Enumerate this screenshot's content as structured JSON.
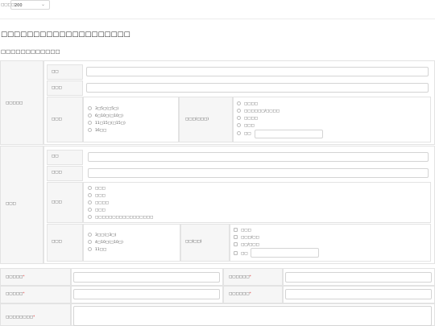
{
  "toolbar": {
    "count_label": "□□□□:",
    "count_value": "200"
  },
  "page_title": "□□□□□□□□□□□□□□□□□□□□",
  "section_title": "□□□□□□□□□□□□",
  "group1": {
    "label": "□□□□□",
    "row1_label": "□□",
    "row2_label": "□□□",
    "row3_label": "□□□",
    "radios": [
      "3□5□(□5□)",
      "6□10□(□10□)",
      "11□15□(□15□)",
      "16□□"
    ],
    "mid_label": "□□□(□□□)",
    "options": [
      "□□□□",
      "□□□□□□/□□□□",
      "□□□□",
      "□□□",
      "□□"
    ]
  },
  "group2": {
    "label": "□□□",
    "row1_label": "□□",
    "row2_label": "□□□",
    "row3_label": "□□□",
    "row3_options": [
      "□□□",
      "□□□",
      "□□□□",
      "□□□",
      "□□□□□□□□□□□□□□□□□"
    ],
    "row4_label": "□□□",
    "radios": [
      "3□□(□3□)",
      "4□10□(□10□)",
      "11□□"
    ],
    "mid_label": "□□(□□)",
    "checks": [
      "□□□",
      "□□□/□□",
      "□□/□□□",
      "□□"
    ]
  },
  "footer": {
    "r1_left": "□□□□□",
    "r1_right": "□□□□□□",
    "r2_left": "□□□□□",
    "r2_right": "□□□□□□",
    "r3_left": "□□□□□□□□"
  }
}
